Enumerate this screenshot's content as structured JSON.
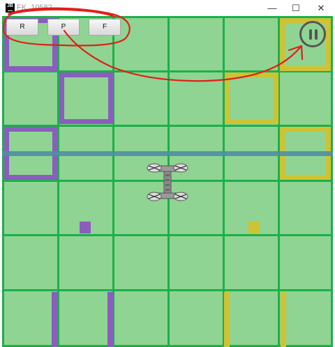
{
  "window": {
    "title": "FK_10582",
    "icon": "JB",
    "minimize_icon": "—",
    "maximize_icon": "☐",
    "close_icon": "✕"
  },
  "controls": {
    "r_label": "R",
    "p_label": "P",
    "f_label": "F"
  },
  "pause_button": {
    "icon": "pause-icon"
  },
  "board": {
    "columns": 6,
    "rows": 6,
    "colors": {
      "background": "#8fd492",
      "grid": "#1bb04a",
      "purple": "#8a5dbf",
      "yellow": "#cfc233",
      "horizontal_bar": "#4e8fa4"
    }
  },
  "annotation": {
    "color": "#e0201a"
  }
}
